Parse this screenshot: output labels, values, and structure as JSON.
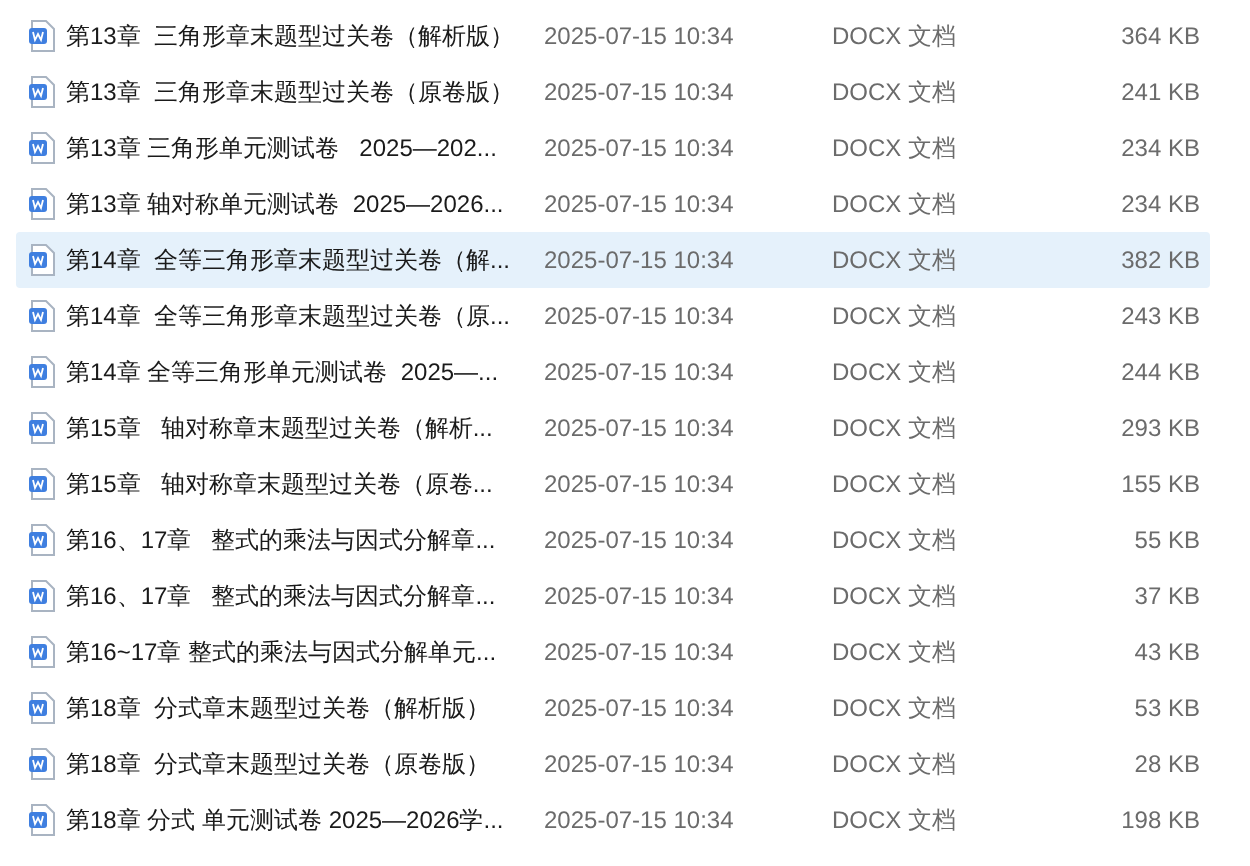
{
  "files": [
    {
      "name": "第13章  三角形章末题型过关卷（解析版）",
      "modified": "2025-07-15 10:34",
      "type": "DOCX 文档",
      "size": "364 KB",
      "selected": false
    },
    {
      "name": "第13章  三角形章末题型过关卷（原卷版）",
      "modified": "2025-07-15 10:34",
      "type": "DOCX 文档",
      "size": "241 KB",
      "selected": false
    },
    {
      "name": "第13章 三角形单元测试卷   2025—202...",
      "modified": "2025-07-15 10:34",
      "type": "DOCX 文档",
      "size": "234 KB",
      "selected": false
    },
    {
      "name": "第13章 轴对称单元测试卷  2025—2026...",
      "modified": "2025-07-15 10:34",
      "type": "DOCX 文档",
      "size": "234 KB",
      "selected": false
    },
    {
      "name": "第14章  全等三角形章末题型过关卷（解...",
      "modified": "2025-07-15 10:34",
      "type": "DOCX 文档",
      "size": "382 KB",
      "selected": true
    },
    {
      "name": "第14章  全等三角形章末题型过关卷（原...",
      "modified": "2025-07-15 10:34",
      "type": "DOCX 文档",
      "size": "243 KB",
      "selected": false
    },
    {
      "name": "第14章 全等三角形单元测试卷  2025—...",
      "modified": "2025-07-15 10:34",
      "type": "DOCX 文档",
      "size": "244 KB",
      "selected": false
    },
    {
      "name": "第15章   轴对称章末题型过关卷（解析...",
      "modified": "2025-07-15 10:34",
      "type": "DOCX 文档",
      "size": "293 KB",
      "selected": false
    },
    {
      "name": "第15章   轴对称章末题型过关卷（原卷...",
      "modified": "2025-07-15 10:34",
      "type": "DOCX 文档",
      "size": "155 KB",
      "selected": false
    },
    {
      "name": "第16、17章   整式的乘法与因式分解章...",
      "modified": "2025-07-15 10:34",
      "type": "DOCX 文档",
      "size": "55 KB",
      "selected": false
    },
    {
      "name": "第16、17章   整式的乘法与因式分解章...",
      "modified": "2025-07-15 10:34",
      "type": "DOCX 文档",
      "size": "37 KB",
      "selected": false
    },
    {
      "name": "第16~17章 整式的乘法与因式分解单元...",
      "modified": "2025-07-15 10:34",
      "type": "DOCX 文档",
      "size": "43 KB",
      "selected": false
    },
    {
      "name": "第18章  分式章末题型过关卷（解析版）",
      "modified": "2025-07-15 10:34",
      "type": "DOCX 文档",
      "size": "53 KB",
      "selected": false
    },
    {
      "name": "第18章  分式章末题型过关卷（原卷版）",
      "modified": "2025-07-15 10:34",
      "type": "DOCX 文档",
      "size": "28 KB",
      "selected": false
    },
    {
      "name": "第18章 分式 单元测试卷 2025—2026学...",
      "modified": "2025-07-15 10:34",
      "type": "DOCX 文档",
      "size": "198 KB",
      "selected": false
    }
  ]
}
